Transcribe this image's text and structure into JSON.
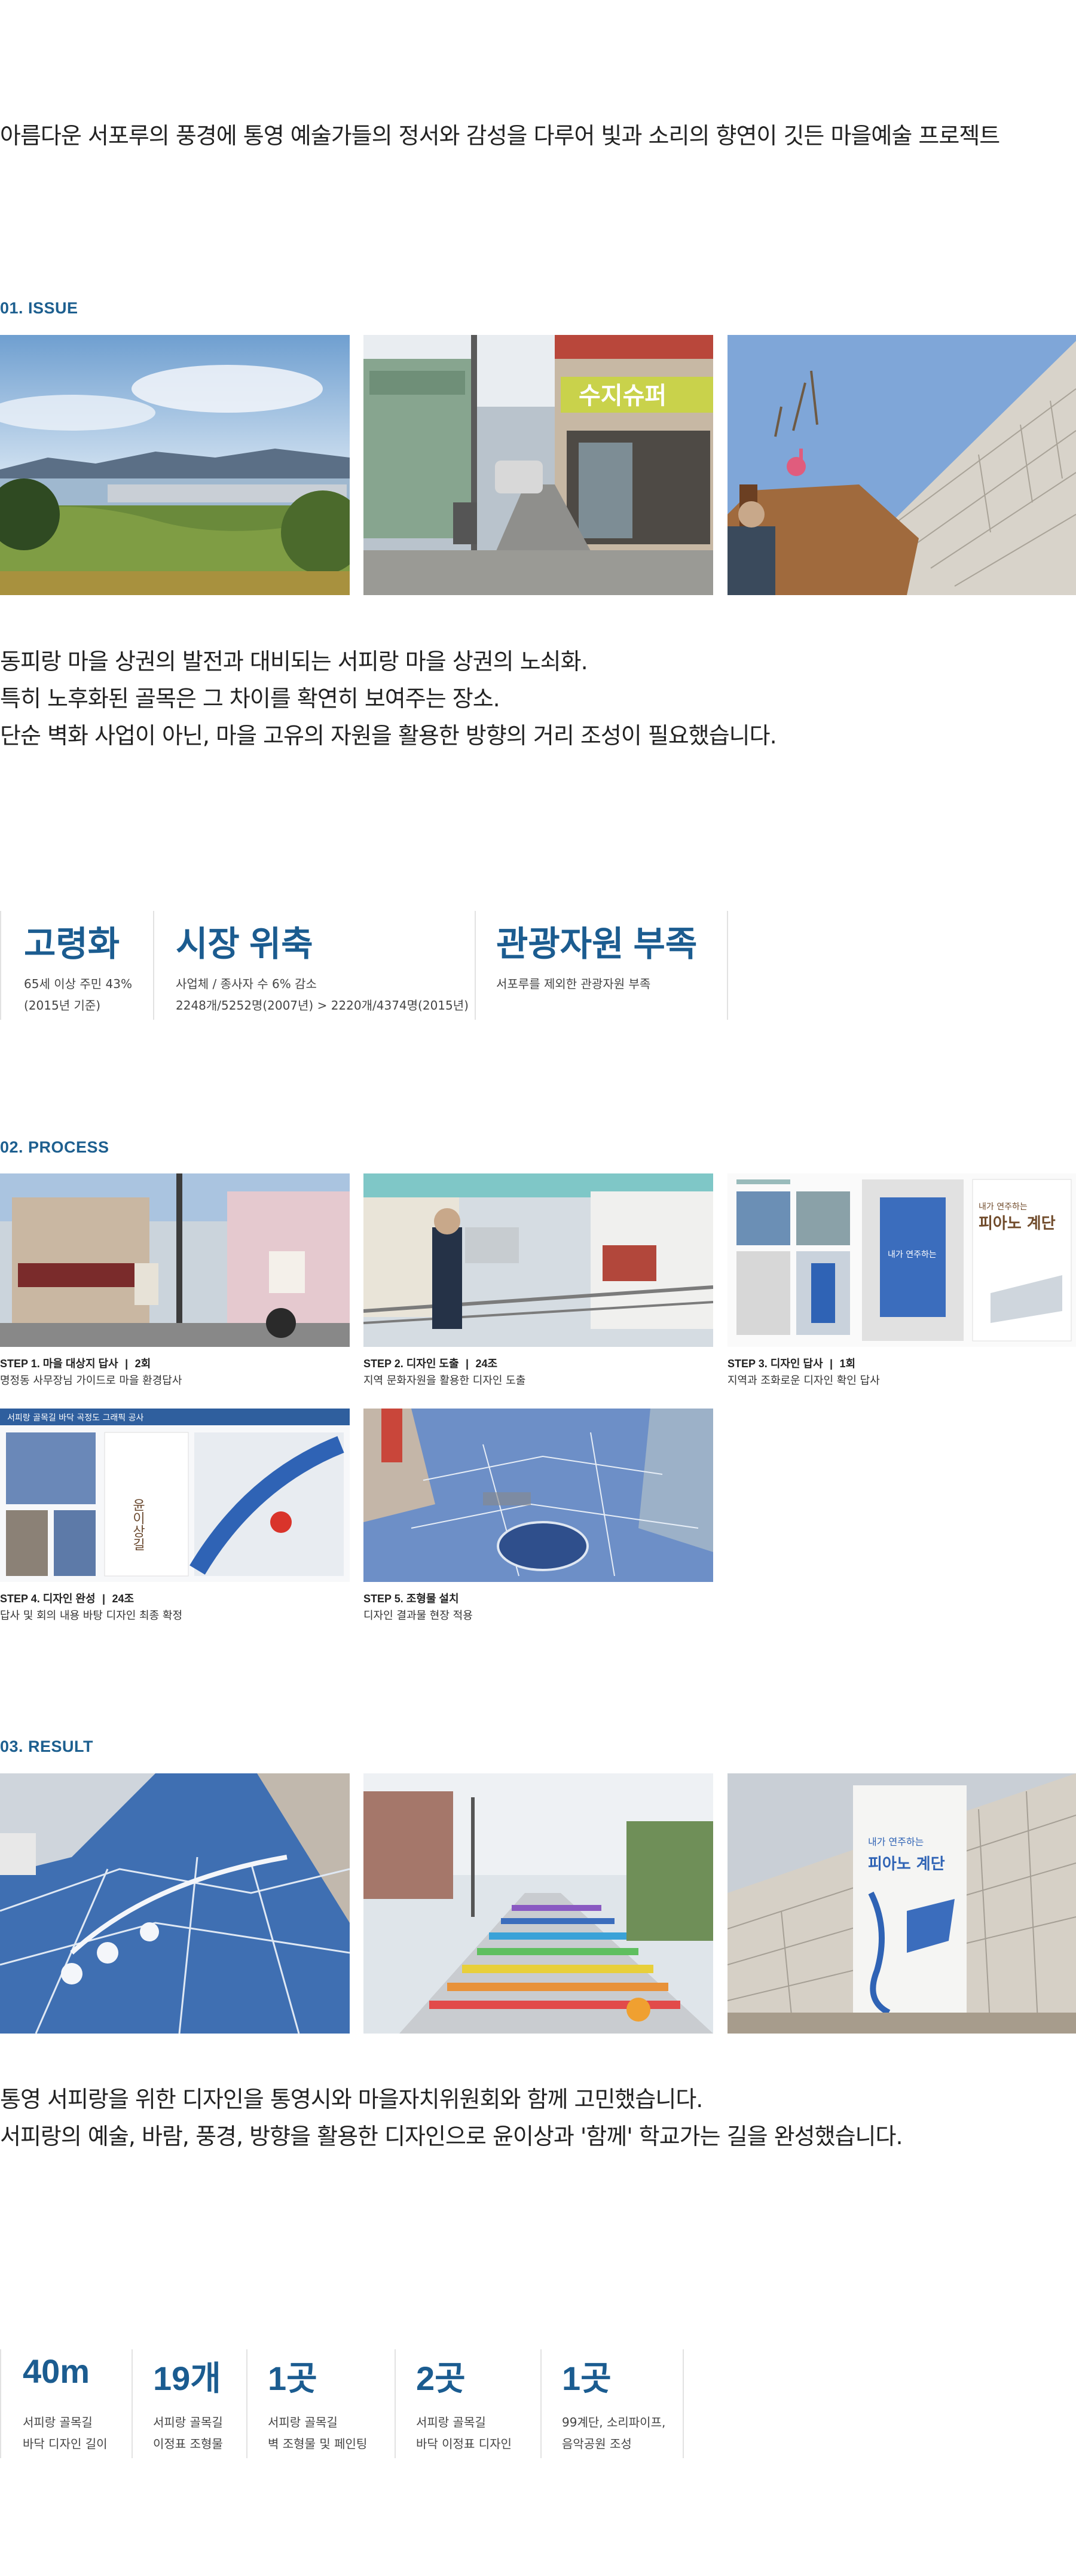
{
  "intro": "아름다운 서포루의 풍경에 통영 예술가들의 정서와 감성을 다루어 빛과 소리의 향연이 깃든 마을예술 프로젝트",
  "issue": {
    "heading": "01. ISSUE",
    "photos": [
      "harbor-landscape-photo",
      "alley-shops-photo",
      "retaining-wall-photo"
    ],
    "lines": [
      "동피랑 마을 상권의 발전과 대비되는 서피랑 마을 상권의 노쇠화.",
      "특히 노후화된 골목은 그 차이를 확연히 보여주는 장소.",
      "단순 벽화 사업이 아닌, 마을 고유의 자원을 활용한 방향의 거리 조성이 필요했습니다."
    ],
    "stats": [
      {
        "title": "고령화",
        "lines": [
          "65세 이상 주민 43%",
          "(2015년 기준)"
        ]
      },
      {
        "title": "시장 위축",
        "lines": [
          "사업체 / 종사자 수 6% 감소",
          "2248개/5252명(2007년) > 2220개/4374명(2015년)"
        ]
      },
      {
        "title": "관광자원 부족",
        "lines": [
          "서포루를 제외한 관광자원 부족"
        ]
      }
    ]
  },
  "process": {
    "heading": "02. PROCESS",
    "steps": [
      {
        "label": "STEP 1. 마을 대상지 답사",
        "count": "2회",
        "desc": "명정동 사무장님 가이드로 마을 환경답사"
      },
      {
        "label": "STEP 2. 디자인 도출",
        "count": "24조",
        "desc": "지역 문화자원을 활용한 디자인 도출"
      },
      {
        "label": "STEP 3. 디자인 답사",
        "count": "1회",
        "desc": "지역과 조화로운 디자인 확인 답사"
      },
      {
        "label": "STEP 4. 디자인 완성",
        "count": "24조",
        "desc": "답사 및 회의 내용 바탕 디자인 최종 확정"
      },
      {
        "label": "STEP 5. 조형물 설치",
        "count": "",
        "desc": "디자인 결과물 현장 적용"
      }
    ],
    "board_texts": {
      "step3_title": "피아노 계단",
      "step3_sub": "내가 연주하는",
      "step4_header": "서피랑 골목길 바닥 곡정도 그래픽 공사",
      "step4_title": "윤이상길"
    },
    "step_separator": "|"
  },
  "result": {
    "heading": "03. RESULT",
    "wall_text_1": "내가 연주하는",
    "wall_text_2": "피아노 계단",
    "lines": [
      "통영 서피랑을 위한 디자인을 통영시와 마을자치위원회와 함께 고민했습니다.",
      "서피랑의 예술, 바람, 풍경, 방향을 활용한 디자인으로 윤이상과 '함께' 학교가는 길을 완성했습니다."
    ],
    "stats": [
      {
        "title": "40m",
        "lines": [
          "서피랑 골목길",
          "바닥 디자인 길이"
        ]
      },
      {
        "title": "19개",
        "lines": [
          "서피랑 골목길",
          "이정표 조형물"
        ]
      },
      {
        "title": "1곳",
        "lines": [
          "서피랑 골목길",
          "벽 조형물 및 페인팅"
        ]
      },
      {
        "title": "2곳",
        "lines": [
          "서피랑 골목길",
          "바닥 이정표 디자인"
        ]
      },
      {
        "title": "1곳",
        "lines": [
          "99계단, 소리파이프,",
          "음악공원 조성"
        ]
      }
    ]
  },
  "colors": {
    "accent": "#1b5c90",
    "heading": "#1d5f8f",
    "pavement": "#3f6fb2"
  },
  "shop_sign": "수지슈퍼"
}
